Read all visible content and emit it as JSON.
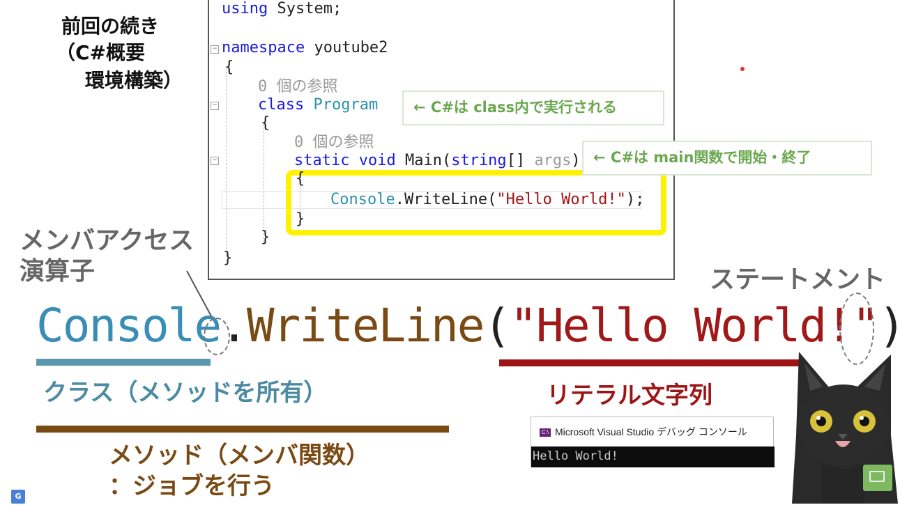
{
  "heading": {
    "line1": "前回の続き",
    "line2": "（C#概要",
    "line3": "環境構築）"
  },
  "code": {
    "line1_kw": "using",
    "line1_rest": " System;",
    "line2_kw": "namespace",
    "line2_rest": " youtube2",
    "open_brace": "{",
    "ref1": "0 個の参照",
    "class_kw": "class",
    "class_name": " Program",
    "ref2": "0 個の参照",
    "main_static": "static",
    "main_void": " void",
    "main_name": " Main(",
    "main_string": "string",
    "main_args_pre": "[] ",
    "main_args": "args",
    "main_args_post": ")",
    "console_type": "Console",
    "console_call": ".WriteLine(",
    "console_str": "\"Hello World!\"",
    "console_end": ");",
    "close_brace": "}"
  },
  "callouts": {
    "class_note": "← C#は class内で実行される",
    "main_note": "← C#は main関数で開始・終了"
  },
  "labels": {
    "member_access_1": "メンバアクセス",
    "member_access_2": "演算子",
    "statement": "ステートメント",
    "class_desc": "クラス（メソッドを所有）",
    "literal": "リテラル文字列",
    "method_1": "メソッド（メンバ関数）",
    "method_2": "：ジョブを行う"
  },
  "big_line": {
    "console": "Console",
    "dot": ".",
    "method": "WriteLine",
    "paren_open": "(",
    "str": "\"Hello World!\"",
    "paren_close": ")",
    "semicolon": ";"
  },
  "console_window": {
    "title": "Microsoft Visual Studio デバッグ コンソール",
    "output": "Hello World!",
    "icon": "visual-studio-icon"
  },
  "colors": {
    "class_color": "#3a8db5",
    "method_color": "#7a4a15",
    "literal_color": "#a01818",
    "highlight": "#fff200",
    "callout_text": "#6aa84f"
  }
}
